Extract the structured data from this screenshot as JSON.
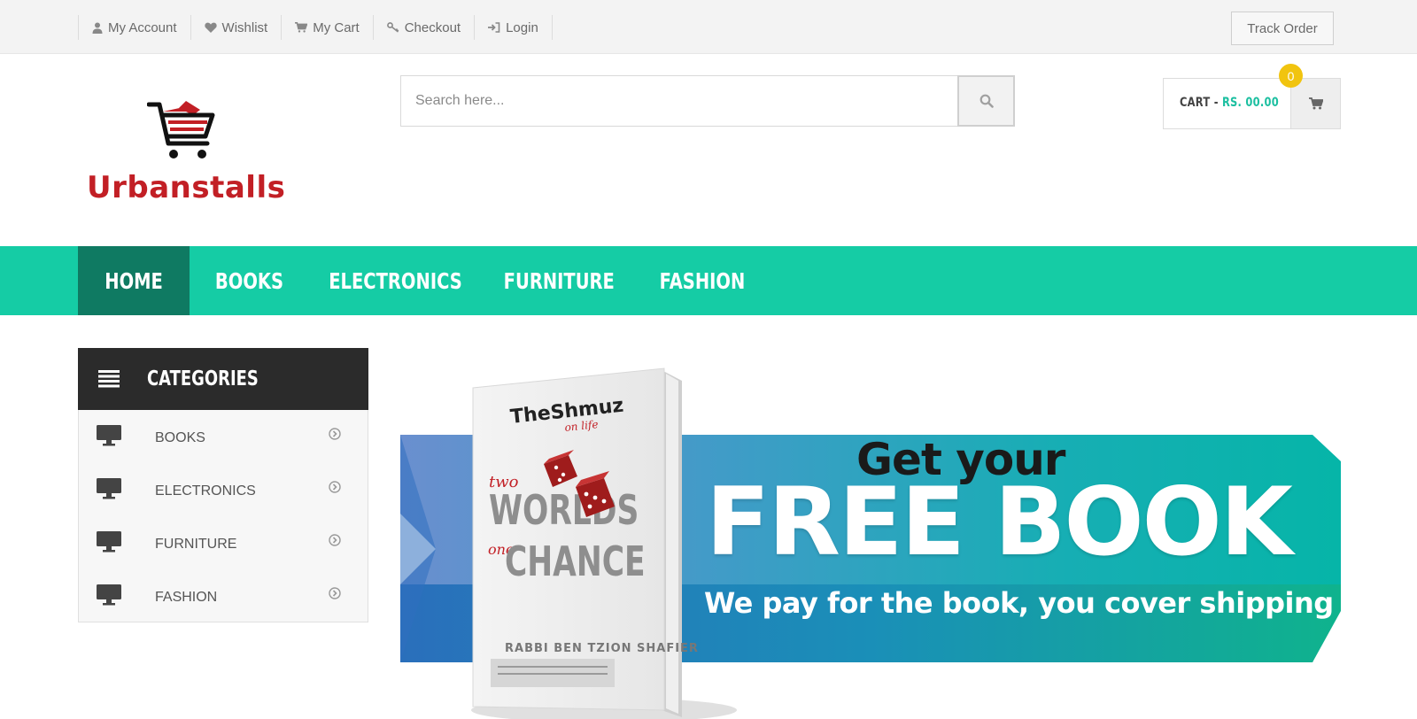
{
  "topbar": {
    "links": [
      {
        "label": "My Account",
        "icon": "user-icon"
      },
      {
        "label": "Wishlist",
        "icon": "heart-icon"
      },
      {
        "label": "My Cart",
        "icon": "cart-icon"
      },
      {
        "label": "Checkout",
        "icon": "key-icon"
      },
      {
        "label": "Login",
        "icon": "sign-in-icon"
      }
    ],
    "track_order": "Track Order"
  },
  "header": {
    "logo_text": "Urbanstalls",
    "search_placeholder": "Search here...",
    "cart_label": "CART - ",
    "cart_amount": "RS. 00.00",
    "cart_count": "0"
  },
  "nav": {
    "items": [
      "HOME",
      "BOOKS",
      "ELECTRONICS",
      "FURNITURE",
      "FASHION"
    ],
    "active": "HOME"
  },
  "categories": {
    "title": "CATEGORIES",
    "items": [
      "BOOKS",
      "ELECTRONICS",
      "FURNITURE",
      "FASHION"
    ]
  },
  "banner": {
    "line1": "Get your",
    "line2": "FREE BOOK",
    "line3": "We pay for the book, you cover shipping",
    "book": {
      "brand": "TheShmuz",
      "brand_tag": "on life",
      "title_small_1": "two",
      "title_big_1": "WORLDS",
      "title_small_2": "one",
      "title_big_2": "CHANCE",
      "author": "RABBI BEN TZION SHAFIER"
    }
  },
  "colors": {
    "accent": "#15cca5",
    "nav_active": "#0f7a62",
    "logo_red": "#c21f25",
    "badge": "#f1c40f",
    "dark": "#2b2b2b"
  }
}
